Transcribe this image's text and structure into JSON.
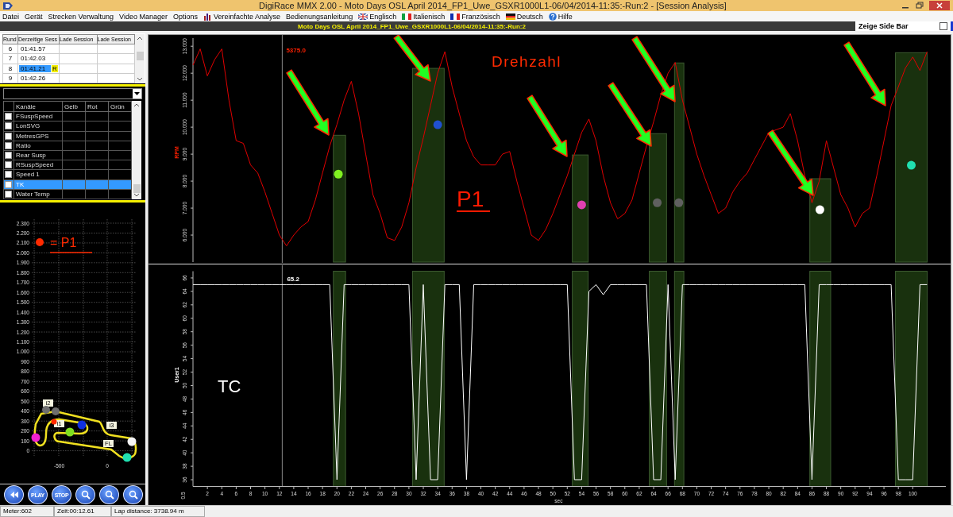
{
  "window": {
    "title": "DigiRace MMX 2.00 -  Moto Days OSL April 2014_FP1_Uwe_GSXR1000L1-06/04/2014-11:35:-Run:2 - [Session Analysis]"
  },
  "menu": [
    {
      "label": "Datei",
      "kind": "plain"
    },
    {
      "label": "Gerät",
      "kind": "plain"
    },
    {
      "label": "Strecken Verwaltung",
      "kind": "plain"
    },
    {
      "label": "Video Manager",
      "kind": "plain"
    },
    {
      "label": "Options",
      "kind": "plain"
    },
    {
      "label": "Vereinfachte Analyse",
      "kind": "chart"
    },
    {
      "label": "Bedienungsanleitung",
      "kind": "plain"
    },
    {
      "label": "Englisch",
      "kind": "flag_gb"
    },
    {
      "label": "Italienisch",
      "kind": "flag_it"
    },
    {
      "label": "Französisch",
      "kind": "flag_fr"
    },
    {
      "label": "Deutsch",
      "kind": "flag_de"
    },
    {
      "label": "Hilfe",
      "kind": "help"
    }
  ],
  "session_bar": {
    "title": "Moto Days OSL April 2014_FP1_Uwe_GSXR1000L1-06/04/2014-11:35:-Run:2",
    "side_bar_toggle": {
      "label": "Zeige Side Bar",
      "checked": false
    }
  },
  "lap_table": {
    "columns": [
      "Rund",
      "Derzeitige Sess",
      "Lade Session",
      "Lade Session"
    ],
    "rows": [
      {
        "lap": "6",
        "time": "01:41.57",
        "selected": false
      },
      {
        "lap": "7",
        "time": "01:42.03",
        "selected": false
      },
      {
        "lap": "8",
        "time": "01:41.21",
        "badge": "R",
        "selected": true
      },
      {
        "lap": "9",
        "time": "01:42.26",
        "selected": false
      }
    ]
  },
  "channel_table": {
    "columns": [
      "Kanäle",
      "Gelb",
      "Rot",
      "Grün"
    ],
    "rows": [
      {
        "name": "FSuspSpeed",
        "checked": false,
        "selected": false
      },
      {
        "name": "LonSVG",
        "checked": false,
        "selected": false
      },
      {
        "name": "MetresGPS",
        "checked": false,
        "selected": false
      },
      {
        "name": "Ratio",
        "checked": false,
        "selected": false
      },
      {
        "name": "Rear Susp",
        "checked": false,
        "selected": false
      },
      {
        "name": "RSuspSpeed",
        "checked": false,
        "selected": false
      },
      {
        "name": "Speed 1",
        "checked": false,
        "selected": false
      },
      {
        "name": "TK",
        "checked": false,
        "selected": true
      },
      {
        "name": "Water Temp",
        "checked": false,
        "selected": false
      }
    ]
  },
  "track_map": {
    "legend": "= P1",
    "yticks": [
      "2.300",
      "2.200",
      "2.100",
      "2.000",
      "1.900",
      "1.800",
      "1.700",
      "1.600",
      "1.500",
      "1.400",
      "1.300",
      "1.200",
      "1.100",
      "1.000",
      "900",
      "800",
      "700",
      "600",
      "500",
      "400",
      "300",
      "200",
      "100",
      "0"
    ],
    "xticks": [
      "-500",
      "0"
    ],
    "sector_labels": [
      "i2",
      "i1",
      "i3",
      "FL"
    ],
    "markers": [
      {
        "color": "#6e6e6e"
      },
      {
        "color": "#6e6e6e"
      },
      {
        "color": "#ff2a00"
      },
      {
        "color": "#1030e0"
      },
      {
        "color": "#7fe020"
      },
      {
        "color": "#f020d0"
      },
      {
        "color": "#f4f4f4"
      },
      {
        "color": "#20e0b0"
      }
    ]
  },
  "playback_buttons": [
    {
      "kind": "rewind"
    },
    {
      "kind": "text",
      "label": "PLAY"
    },
    {
      "kind": "text",
      "label": "STOP"
    },
    {
      "kind": "zoom"
    },
    {
      "kind": "zoom"
    },
    {
      "kind": "zoom"
    }
  ],
  "rpm_chart": {
    "cursor_value": "5375.0",
    "title": "Drehzahl",
    "label": "P1",
    "markers": [
      {
        "color": "#80f020"
      },
      {
        "color": "#2050d0"
      },
      {
        "color": "#e040b0"
      },
      {
        "color": "#606060"
      },
      {
        "color": "#606060"
      },
      {
        "color": "#ffffff"
      },
      {
        "color": "#20e0b0"
      }
    ],
    "chart_data": {
      "type": "line",
      "ylim": [
        5,
        13.3
      ],
      "yticks": [
        {
          "value": 6,
          "label": "6.000"
        },
        {
          "value": 7,
          "label": "7.000"
        },
        {
          "value": 8,
          "label": "8.000"
        },
        {
          "value": 9,
          "label": "9.000"
        },
        {
          "value": 10,
          "label": "10.000"
        },
        {
          "value": 11,
          "label": "11.000"
        },
        {
          "value": 12,
          "label": "12.000"
        },
        {
          "value": 13,
          "label": "13.000"
        }
      ],
      "series": [
        {
          "name": "RPM",
          "color": "#e00000",
          "values": [
            12.3,
            12.9,
            11.9,
            12.5,
            12.9,
            11.0,
            9.5,
            9.4,
            8.6,
            8.3,
            7.6,
            6.8,
            6.0,
            5.6,
            6.0,
            6.3,
            6.5,
            7.3,
            8.3,
            9.3,
            10.1,
            11.0,
            11.7,
            10.5,
            9.0,
            7.5,
            6.8,
            5.9,
            5.8,
            6.3,
            7.2,
            8.5,
            9.6,
            10.8,
            12.0,
            12.8,
            11.5,
            10.5,
            9.5,
            8.9,
            8.6,
            8.6,
            8.6,
            9.0,
            9.1,
            8.0,
            7.0,
            6.0,
            5.8,
            6.2,
            6.8,
            7.5,
            8.2,
            9.0,
            9.8,
            10.3,
            9.5,
            8.2,
            7.2,
            6.6,
            6.8,
            7.3,
            8.3,
            9.3,
            10.2,
            11.2,
            12.0,
            12.4,
            11.0,
            10.0,
            9.0,
            8.2,
            7.5,
            6.8,
            7.0,
            7.6,
            8.0,
            8.3,
            8.8,
            9.3,
            9.8,
            9.9,
            10.0,
            10.5,
            9.5,
            8.2,
            7.2,
            8.0,
            9.5,
            8.5,
            7.5,
            7.0,
            6.3,
            6.8,
            7.0,
            8.2,
            9.5,
            10.8,
            11.5,
            12.2,
            12.6,
            12.1,
            12.8
          ]
        }
      ]
    }
  },
  "tc_chart": {
    "cursor_value": "65.2",
    "label": "TC",
    "axis_corner": "0.5",
    "chart_data": {
      "type": "line",
      "xlabel": "sec",
      "xlim": [
        0,
        104.6
      ],
      "ylim": [
        35,
        67
      ],
      "yticks": [
        36,
        38,
        40,
        42,
        44,
        46,
        48,
        50,
        52,
        54,
        56,
        58,
        60,
        62,
        64,
        66
      ],
      "xticks": [
        2,
        4,
        6,
        8,
        10,
        12,
        14,
        16,
        18,
        20,
        22,
        24,
        26,
        28,
        30,
        32,
        34,
        36,
        38,
        40,
        42,
        44,
        46,
        48,
        50,
        52,
        54,
        56,
        58,
        60,
        62,
        64,
        66,
        68,
        70,
        72,
        74,
        76,
        78,
        80,
        82,
        84,
        86,
        88,
        90,
        92,
        94,
        96,
        98,
        100
      ],
      "x": [
        0,
        1,
        2,
        3,
        4,
        5,
        6,
        7,
        8,
        9,
        10,
        11,
        12,
        13,
        14,
        15,
        16,
        17,
        18,
        19,
        20,
        21,
        22,
        23,
        24,
        25,
        26,
        27,
        28,
        29,
        30,
        31,
        32,
        33,
        34,
        35,
        36,
        37,
        38,
        39,
        40,
        41,
        42,
        43,
        44,
        45,
        46,
        47,
        48,
        49,
        50,
        51,
        52,
        53,
        54,
        55,
        56,
        57,
        58,
        59,
        60,
        61,
        62,
        63,
        64,
        65,
        66,
        67,
        68,
        69,
        70,
        71,
        72,
        73,
        74,
        75,
        76,
        77,
        78,
        79,
        80,
        81,
        82,
        83,
        84,
        85,
        86,
        87,
        88,
        89,
        90,
        91,
        92,
        93,
        94,
        95,
        96,
        97,
        98,
        99,
        100,
        101,
        102
      ],
      "series": [
        {
          "name": "User1",
          "color": "#ffffff",
          "values": [
            65,
            65,
            65,
            65,
            65,
            65,
            65,
            65,
            65,
            65,
            65,
            65,
            65,
            65,
            65,
            65,
            65,
            65,
            65,
            65,
            36,
            65,
            65,
            65,
            65,
            65,
            65,
            65,
            65,
            65,
            65,
            36,
            65,
            36,
            36,
            65,
            65,
            65,
            36,
            65,
            65,
            65,
            65,
            65,
            65,
            65,
            65,
            65,
            65,
            65,
            65,
            65,
            65,
            36,
            36,
            64,
            65,
            63.5,
            65,
            65,
            65,
            65,
            65,
            65,
            36,
            36,
            65,
            36,
            65,
            65,
            65,
            65,
            65,
            65,
            65,
            65,
            65,
            65,
            65,
            65,
            65,
            65,
            65,
            65,
            65,
            65,
            36,
            65,
            65,
            65,
            65,
            65,
            65,
            65,
            65,
            65,
            65,
            65,
            36,
            36,
            36,
            65,
            65
          ]
        }
      ]
    }
  },
  "status_bar": [
    "Meter:602",
    "Zeit:00:12.61",
    "Lap distance: 3738.94 m"
  ]
}
